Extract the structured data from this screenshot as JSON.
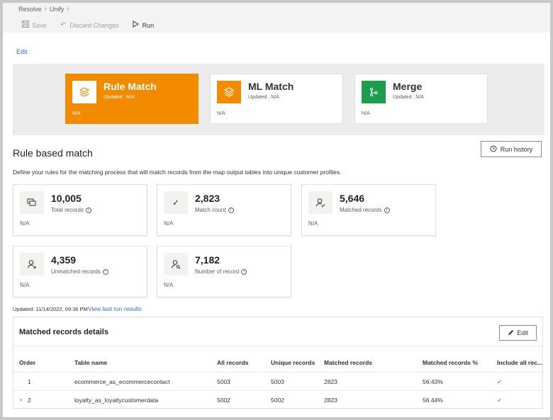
{
  "breadcrumb": [
    "Resolve",
    "Unify"
  ],
  "toolbar": {
    "save_label": "Save",
    "discard_label": "Discard Changes",
    "run_label": "Run"
  },
  "edit_link": "Edit",
  "tiles": [
    {
      "title": "Rule Match",
      "updated": "Updated : N/A",
      "status": "N/A",
      "icon": "layers-icon",
      "color": "#f38b00"
    },
    {
      "title": "ML Match",
      "updated": "Updated : N/A",
      "status": "N/A",
      "icon": "layers-icon",
      "color": "#f38b00"
    },
    {
      "title": "Merge",
      "updated": "Updated : N/A",
      "status": "N/A",
      "icon": "merge-icon",
      "color": "#1a9e4b"
    }
  ],
  "section": {
    "title": "Rule based match",
    "run_history_label": "Run history",
    "description": "Define your rules for the matching process that will match records from the map output tables into unique customer profiles."
  },
  "stats": [
    {
      "value": "10,005",
      "label": "Total records",
      "status": "N/A",
      "icon": "records-icon"
    },
    {
      "value": "2,823",
      "label": "Match count",
      "status": "N/A",
      "icon": "check-icon"
    },
    {
      "value": "5,646",
      "label": "Matched records",
      "status": "N/A",
      "icon": "person-check-icon"
    },
    {
      "value": "4,359",
      "label": "Unmatched records",
      "status": "N/A",
      "icon": "person-x-icon"
    },
    {
      "value": "7,182",
      "label": "Number of record",
      "status": "N/A",
      "icon": "person-search-icon"
    }
  ],
  "updated_text": "Updated: 11/14/2022, 09:36 PM",
  "last_run_link": "View last run results",
  "details": {
    "title": "Matched records details",
    "edit_label": "Edit",
    "columns": [
      "Order",
      "Table name",
      "All records",
      "Unique records",
      "Matched records",
      "Matched records %",
      "Include all rec..."
    ],
    "rows": [
      {
        "order": "1",
        "table": "ecommerce_as_ecommercecontact",
        "all": "5003",
        "unique": "5003",
        "matched": "2823",
        "pct": "56.43%",
        "include": "✓",
        "expandable": false
      },
      {
        "order": "2",
        "table": "loyalty_as_loyaltycustomerdata",
        "all": "5002",
        "unique": "5002",
        "matched": "2823",
        "pct": "56.44%",
        "include": "✓",
        "expandable": true
      }
    ]
  }
}
